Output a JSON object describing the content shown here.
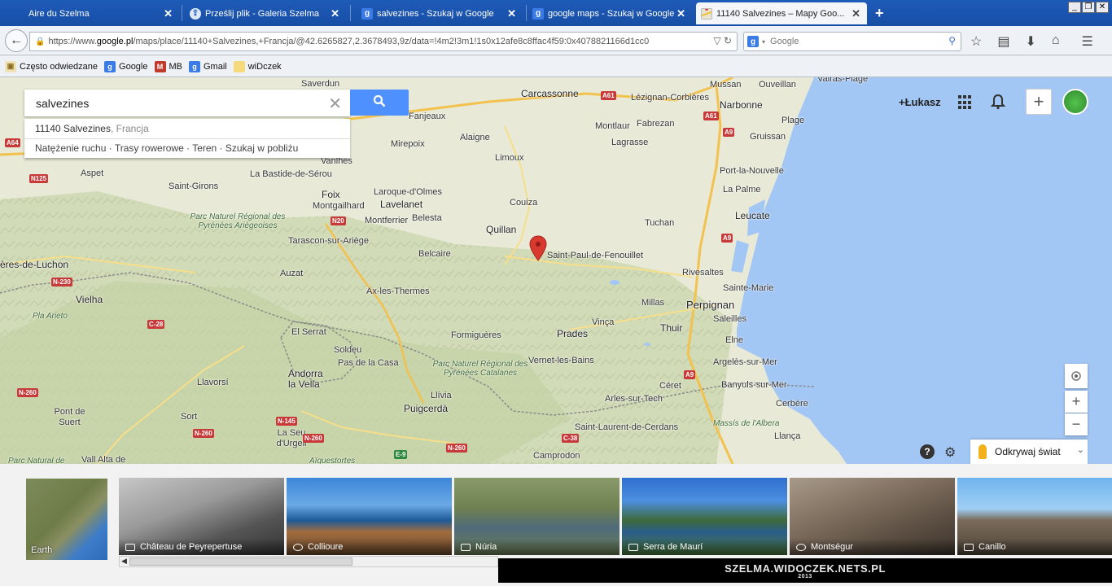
{
  "browser": {
    "tabs": [
      {
        "title": "Aire du Szelma",
        "icon": "blank-page-icon",
        "active": false
      },
      {
        "title": "Prześlij plik - Galeria Szelma",
        "icon": "upload-favicon",
        "active": false
      },
      {
        "title": "salvezines - Szukaj w Google",
        "icon": "google-favicon",
        "active": false
      },
      {
        "title": "google maps - Szukaj w Google",
        "icon": "google-favicon",
        "active": false
      },
      {
        "title": "11140 Salvezines – Mapy Goo...",
        "icon": "maps-favicon",
        "active": true
      }
    ],
    "window_buttons": [
      "_",
      "❐",
      "✕"
    ],
    "url_prefix": "https://www.",
    "url_domain": "google.pl",
    "url_rest": "/maps/place/11140+Salvezines,+Francja/@42.6265827,2.3678493,9z/data=!4m2!3m1!1s0x12afe8c8ffac4f59:0x4078821166d1cc0",
    "search_engine_placeholder": "Google",
    "bookmarks": [
      {
        "label": "Często odwiedzane",
        "icon": "bookmark-folder-icon"
      },
      {
        "label": "Google",
        "icon": "google-favicon"
      },
      {
        "label": "MB",
        "icon": "mb-favicon"
      },
      {
        "label": "Gmail",
        "icon": "google-favicon"
      },
      {
        "label": "wiDczek",
        "icon": "folder-icon"
      }
    ]
  },
  "maps": {
    "search_query": "salvezines",
    "suggestion_main": "11140 Salvezines",
    "suggestion_sub": ", Francja",
    "suggestion_links": "Natężenie ruchu · Trasy rowerowe · Teren · Szukaj w pobliżu",
    "user_name": "+Łukasz",
    "explore_label": "Odkrywaj świat",
    "zoom_in": "+",
    "zoom_out": "−",
    "places": [
      {
        "name": "Saverdun"
      },
      {
        "name": "Fanjeaux"
      },
      {
        "name": "Carcassonne"
      },
      {
        "name": "Lézignan-Corbières"
      },
      {
        "name": "Narbonne"
      },
      {
        "name": "Montlaur"
      },
      {
        "name": "Fabrezan"
      },
      {
        "name": "Mirepoix"
      },
      {
        "name": "Alaigne"
      },
      {
        "name": "Lagrasse"
      },
      {
        "name": "Gruissan"
      },
      {
        "name": "Aspet"
      },
      {
        "name": "La Bastide-de-Sérou"
      },
      {
        "name": "Limoux"
      },
      {
        "name": "Port-la-Nouvelle"
      },
      {
        "name": "Saint-Girons"
      },
      {
        "name": "Foix"
      },
      {
        "name": "Laroque-d'Olmes"
      },
      {
        "name": "Lavelanet"
      },
      {
        "name": "Couiza"
      },
      {
        "name": "La Palme"
      },
      {
        "name": "Montgailhard"
      },
      {
        "name": "Montferrier"
      },
      {
        "name": "Belesta"
      },
      {
        "name": "Tuchan"
      },
      {
        "name": "Leucate"
      },
      {
        "name": "Tarascon-sur-Ariège"
      },
      {
        "name": "Quillan"
      },
      {
        "name": "Belcaire"
      },
      {
        "name": "Saint-Paul-de-Fenouillet"
      },
      {
        "name": "ères-de-Luchon"
      },
      {
        "name": "Auzat"
      },
      {
        "name": "Rivesaltes"
      },
      {
        "name": "Sainte-Marie"
      },
      {
        "name": "Ax-les-Thermes"
      },
      {
        "name": "Vielha"
      },
      {
        "name": "Millas"
      },
      {
        "name": "Perpignan"
      },
      {
        "name": "Saleilles"
      },
      {
        "name": "El Serrat"
      },
      {
        "name": "Formiguères"
      },
      {
        "name": "Prades"
      },
      {
        "name": "Vinça"
      },
      {
        "name": "Thuir"
      },
      {
        "name": "Elne"
      },
      {
        "name": "Soldeu"
      },
      {
        "name": "Pas de la Casa"
      },
      {
        "name": "Vernet-les-Bains"
      },
      {
        "name": "Argelès-sur-Mer"
      },
      {
        "name": "Andorra la Vella"
      },
      {
        "name": "Llavorsí"
      },
      {
        "name": "Céret"
      },
      {
        "name": "Banyuls-sur-Mer"
      },
      {
        "name": "Llívia"
      },
      {
        "name": "Arles-sur-Tech"
      },
      {
        "name": "Cerbère"
      },
      {
        "name": "Sort"
      },
      {
        "name": "Puigcerdà"
      },
      {
        "name": "Pont de Suert"
      },
      {
        "name": "La Seu d'Urgell"
      },
      {
        "name": "Saint-Laurent-de-Cerdans"
      },
      {
        "name": "Llança"
      },
      {
        "name": "Vall Alta de"
      },
      {
        "name": "Camprodon"
      },
      {
        "name": "Massís de l'Albera"
      },
      {
        "name": "Plage"
      },
      {
        "name": "Valras-Plage"
      },
      {
        "name": "Mussan"
      },
      {
        "name": "Ouveillan"
      },
      {
        "name": "Varilhes"
      },
      {
        "name": "Pla Arieto"
      }
    ],
    "parks": [
      {
        "name": "Parc Naturel Régional des Pyrénées Ariégeoises"
      },
      {
        "name": "Parc Naturel Régional des Pyrénées Catalanes"
      },
      {
        "name": "Parc Natural de"
      },
      {
        "name": "Aïguestortes"
      }
    ],
    "roads": [
      {
        "label": "A64",
        "color": "red"
      },
      {
        "label": "N125",
        "color": "red"
      },
      {
        "label": "N20",
        "color": "red"
      },
      {
        "label": "A61",
        "color": "red"
      },
      {
        "label": "A61",
        "color": "red"
      },
      {
        "label": "A9",
        "color": "red"
      },
      {
        "label": "A9",
        "color": "red"
      },
      {
        "label": "A9",
        "color": "red"
      },
      {
        "label": "N-230",
        "color": "red"
      },
      {
        "label": "C-28",
        "color": "red"
      },
      {
        "label": "N-260",
        "color": "red"
      },
      {
        "label": "N-145",
        "color": "red"
      },
      {
        "label": "N-260",
        "color": "red"
      },
      {
        "label": "N-260",
        "color": "red"
      },
      {
        "label": "N-260",
        "color": "red"
      },
      {
        "label": "C-38",
        "color": "red"
      },
      {
        "label": "E-9",
        "color": "green"
      }
    ]
  },
  "photos": {
    "earth_label": "Earth",
    "items": [
      {
        "caption": "Château de Peyrepertuse"
      },
      {
        "caption": "Collioure"
      },
      {
        "caption": "Núria"
      },
      {
        "caption": "Serra de Maurí"
      },
      {
        "caption": "Montségur"
      },
      {
        "caption": "Canillo"
      }
    ]
  },
  "watermark": {
    "text": "SZELMA.WIDOCZEK.NETS.PL",
    "year": "2013"
  },
  "colors": {
    "tabbar": "#1e5bb8",
    "search_button": "#4d90fe",
    "sea": "#a3c7f5",
    "land": "#e8ead7",
    "road_red": "#c8393a",
    "pin": "#d93a2f"
  }
}
